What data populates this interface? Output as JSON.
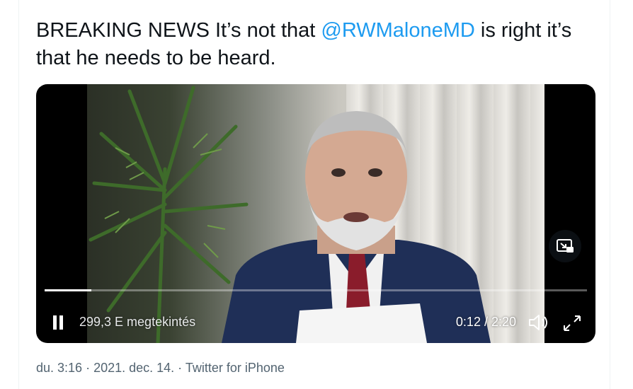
{
  "tweet": {
    "text_before": "BREAKING NEWS It’s not that ",
    "mention": "@RWMaloneMD",
    "text_after": " is right it’s that he needs to be heard."
  },
  "video": {
    "views": "299,3 E megtekintés",
    "time": "0:12 / 2:20",
    "progress_fraction": 0.0857,
    "icons": {
      "play": "pause-icon",
      "volume": "volume-icon",
      "fullscreen": "fullscreen-icon",
      "pip": "picture-in-picture-icon"
    }
  },
  "meta": {
    "time": "du. 3:16",
    "sep1": " · ",
    "date": "2021. dec. 14.",
    "sep2": " · ",
    "source": "Twitter for iPhone"
  },
  "colors": {
    "mention": "#1d9bf0",
    "meta": "#536471"
  }
}
